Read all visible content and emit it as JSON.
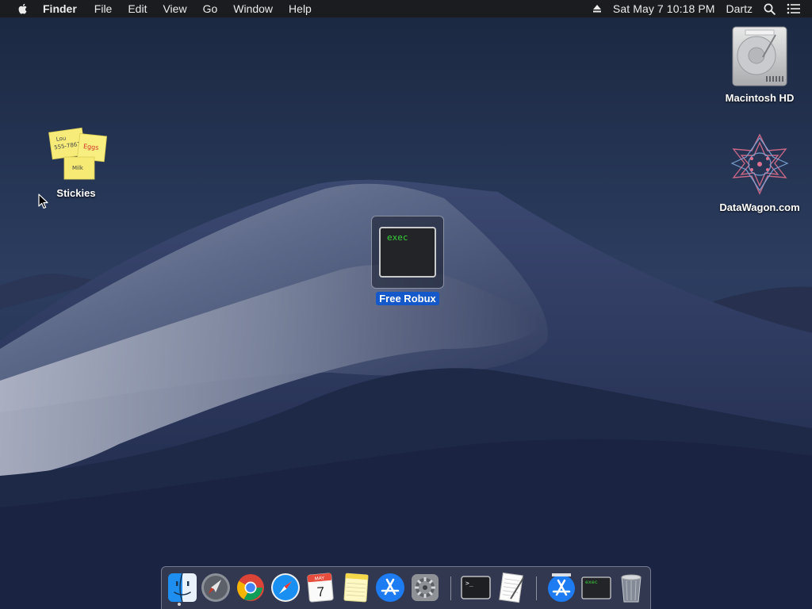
{
  "menubar": {
    "apple_icon": "apple-logo-icon",
    "app_name": "Finder",
    "menus": [
      "File",
      "Edit",
      "View",
      "Go",
      "Window",
      "Help"
    ],
    "clock": "Sat May 7  10:18 PM",
    "user": "Dartz",
    "status_icons": [
      "eject-icon",
      "spotlight-search-icon",
      "notification-center-icon"
    ]
  },
  "desktop": {
    "stickies": {
      "label": "Stickies",
      "note_lines": [
        "Lou",
        "555-7861",
        "Eggs",
        "Milk"
      ]
    },
    "macintosh_hd": {
      "label": "Macintosh HD"
    },
    "datawagon": {
      "label": "DataWagon.com"
    },
    "free_robux": {
      "label": "Free Robux",
      "icon_text": "exec",
      "selected": true
    }
  },
  "dock": {
    "calendar": {
      "month": "MAY",
      "day": "7"
    },
    "exec_icon_text": "exec",
    "items": [
      "finder",
      "launchpad",
      "chrome",
      "safari",
      "calendar",
      "notes",
      "app-store",
      "system-preferences",
      "terminal",
      "textedit",
      "app-store-2",
      "exec-document",
      "trash"
    ]
  },
  "colors": {
    "menubar_bg": "#1b1c20",
    "selection": "#1558c9",
    "terminal_green": "#38d13c"
  }
}
